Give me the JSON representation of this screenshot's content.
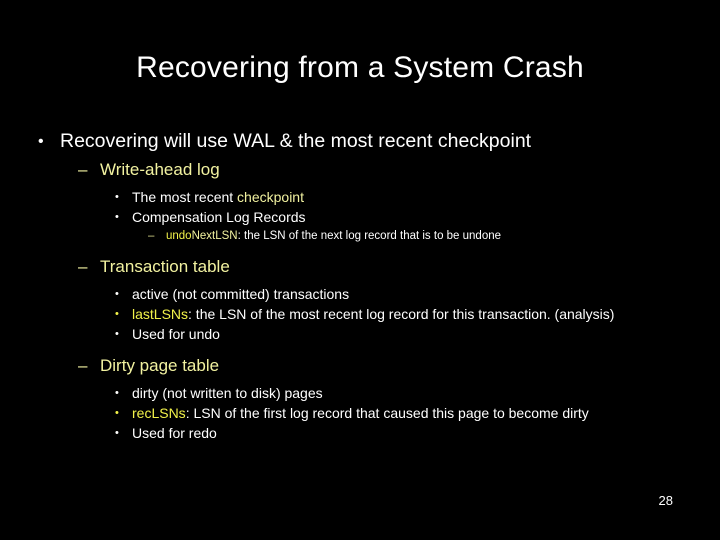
{
  "slide": {
    "title": "Recovering from a System Crash",
    "page_number": "28",
    "background_color": "#000000",
    "text_color": "#ffffff",
    "accent_color": "#f2f2a0",
    "highlight_color": "#f2f24a",
    "bullets": {
      "level1": "•",
      "level2": "–",
      "level3": "•",
      "level4": "–"
    },
    "content": {
      "l1_recovering": "Recovering will use WAL & the most recent checkpoint",
      "l2_wal": "Write-ahead log",
      "l3_checkpoint_a": "The most recent ",
      "l3_checkpoint_b": "checkpoint",
      "l3_clr": "Compensation Log Records",
      "l4_undonextlsn_a": "undo",
      "l4_undonextlsn_b": "NextLSN",
      "l4_undonextlsn_c": ": the LSN of the next log record that is to be undone",
      "l2_transaction_table": "Transaction table",
      "l3_active": "active (not committed) transactions",
      "l3_lastlsns_a": "lastLSNs",
      "l3_lastlsns_b": ": the LSN of the most recent log record for this transaction. (analysis)",
      "l3_used_undo": "Used for undo",
      "l2_dirty_page_table": "Dirty page table",
      "l3_dirty": "dirty (not written to disk) pages",
      "l3_reclsns_a": "recLSNs",
      "l3_reclsns_b": ": LSN of the first log record that caused this page to become dirty",
      "l3_used_redo": "Used for redo"
    }
  }
}
